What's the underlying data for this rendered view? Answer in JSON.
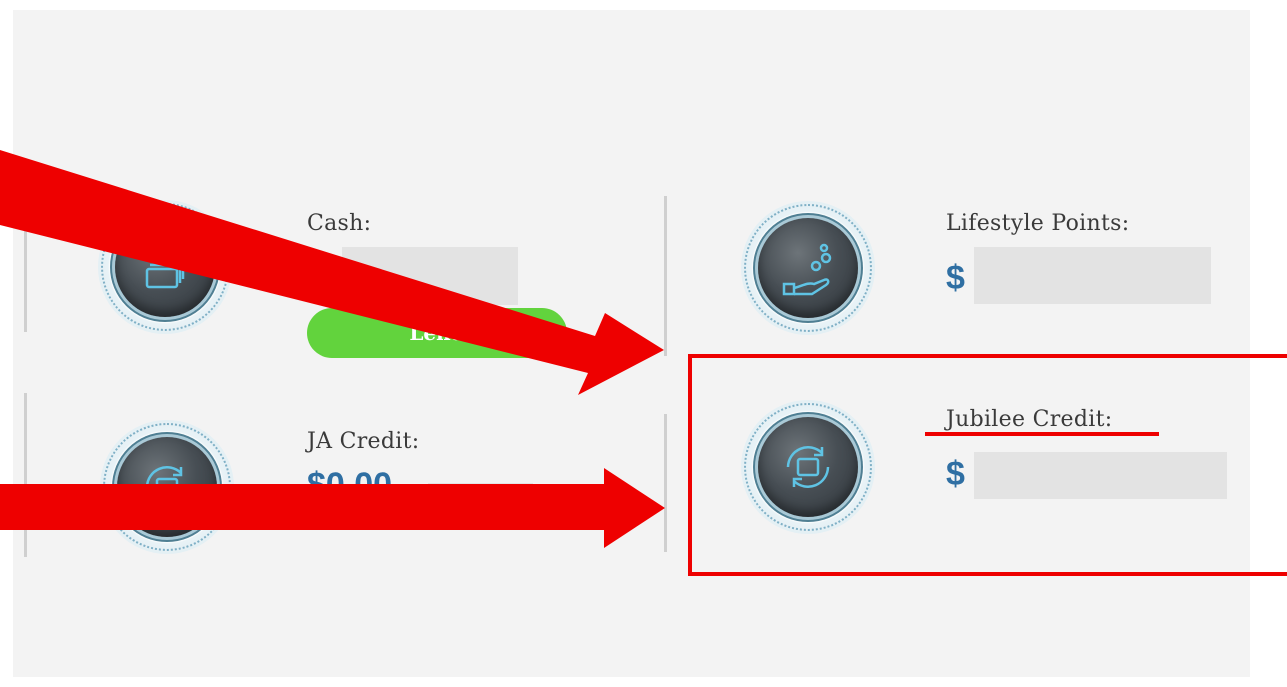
{
  "cards": [
    {
      "label": "Cash:",
      "currency": "$",
      "icon": "cash-stack-icon",
      "button": "Lend"
    },
    {
      "label": "Lifestyle Points:",
      "currency": "$",
      "icon": "hand-coins-icon"
    },
    {
      "label": "JA Credit:",
      "currency": "$",
      "amount_partial": "$0.00",
      "icon": "exchange-cycle-icon"
    },
    {
      "label": "Jubilee Credit:",
      "currency": "$",
      "icon": "exchange-cycle-icon"
    }
  ],
  "colors": {
    "accent_blue": "#2f6fa3",
    "button_green": "#62d33d",
    "annotation_red": "#ee0000",
    "panel_bg": "#f3f3f3"
  }
}
